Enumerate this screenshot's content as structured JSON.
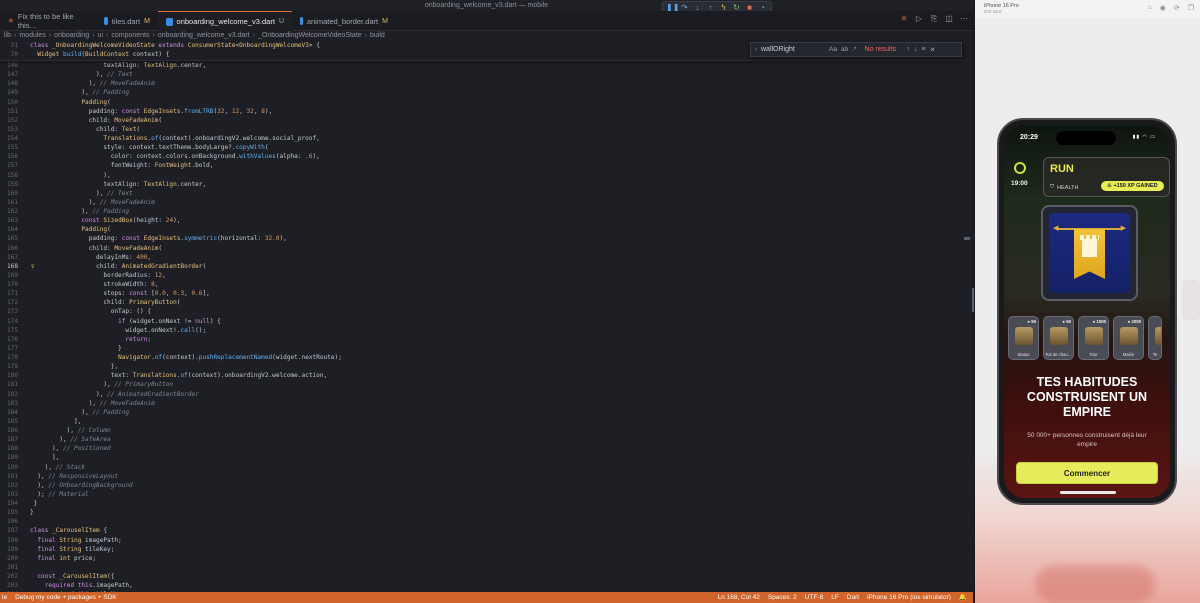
{
  "editor": {
    "window_title": "onboarding_welcome_v3.dart — mobile",
    "tabs": [
      {
        "label": "Fix this to be like this…",
        "mod": ""
      },
      {
        "label": "tiles.dart",
        "mod": "M"
      },
      {
        "label": "onboarding_welcome_v3.dart",
        "mod": "U"
      },
      {
        "label": "animated_border.dart",
        "mod": "M"
      }
    ],
    "breadcrumb": [
      "lib",
      "modules",
      "onboarding",
      "ui",
      "components",
      "onboarding_welcome_v3.dart",
      "_OnboardingWelcomeVideoState",
      "build"
    ],
    "find": {
      "query": "wallORight",
      "aa": "Aa",
      "word": "ab",
      "regex": ".*",
      "result": "No results"
    },
    "sticky": [
      {
        "num": "31",
        "html": "<span class='k'>class</span> <span class='t'>_OnboardingWelcomeVideoState</span> <span class='k'>extends</span> <span class='t'>ConsumerState</span>&lt;<span class='t'>OnboardingWelcomeV3</span>&gt; {"
      },
      {
        "num": "70",
        "html": "  <span class='t'>Widget</span> <span class='f'>build</span>(<span class='t'>BuildContext</span> context) {"
      }
    ],
    "lines": [
      {
        "num": "146",
        "html": "                    textAlign: <span class='t'>TextAlign</span>.center,"
      },
      {
        "num": "147",
        "html": "                  ), <span class='c'>// Text</span>"
      },
      {
        "num": "148",
        "html": "                ), <span class='c'>// MoveFadeAnim</span>"
      },
      {
        "num": "149",
        "html": "              ), <span class='c'>// Padding</span>"
      },
      {
        "num": "150",
        "html": "              <span class='t'>Padding</span>("
      },
      {
        "num": "151",
        "html": "                padding: <span class='k'>const</span> <span class='t'>EdgeInsets</span>.<span class='f'>fromLTRB</span>(<span class='n'>32</span>, <span class='n'>12</span>, <span class='n'>32</span>, <span class='n'>8</span>),"
      },
      {
        "num": "152",
        "html": "                child: <span class='t'>MoveFadeAnim</span>("
      },
      {
        "num": "153",
        "html": "                  child: <span class='t'>Text</span>("
      },
      {
        "num": "154",
        "html": "                    <span class='t'>Translations</span>.<span class='f'>of</span>(context).onboardingV2.welcome.social_proof,"
      },
      {
        "num": "155",
        "html": "                    style: context.textTheme.bodyLarge?.<span class='f'>copyWith</span>("
      },
      {
        "num": "156",
        "html": "                      color: context.colors.onBackground.<span class='f'>withValues</span>(alpha: <span class='n'>.6</span>),"
      },
      {
        "num": "157",
        "html": "                      fontWeight: <span class='t'>FontWeight</span>.bold,"
      },
      {
        "num": "158",
        "html": "                    ),"
      },
      {
        "num": "159",
        "html": "                    textAlign: <span class='t'>TextAlign</span>.center,"
      },
      {
        "num": "160",
        "html": "                  ), <span class='c'>// Text</span>"
      },
      {
        "num": "161",
        "html": "                ), <span class='c'>// MoveFadeAnim</span>"
      },
      {
        "num": "162",
        "html": "              ), <span class='c'>// Padding</span>"
      },
      {
        "num": "163",
        "html": "              <span class='k'>const</span> <span class='t'>SizedBox</span>(height: <span class='n'>24</span>),"
      },
      {
        "num": "164",
        "html": "              <span class='t'>Padding</span>("
      },
      {
        "num": "165",
        "html": "                padding: <span class='k'>const</span> <span class='t'>EdgeInsets</span>.<span class='f'>symmetric</span>(horizontal: <span class='n'>32.0</span>),"
      },
      {
        "num": "166",
        "html": "                child: <span class='t'>MoveFadeAnim</span>("
      },
      {
        "num": "167",
        "html": "                  delayInMs: <span class='n'>400</span>,"
      },
      {
        "num": "168",
        "html": "                  child: <span class='t'>AnimatedGradientBorder</span>("
      },
      {
        "num": "169",
        "html": "                    borderRadius: <span class='n'>12</span>,"
      },
      {
        "num": "170",
        "html": "                    strokeWidth: <span class='n'>8</span>,"
      },
      {
        "num": "171",
        "html": "                    stops: <span class='k'>const</span> [<span class='n'>0.0</span>, <span class='n'>0.3</span>, <span class='n'>0.6</span>],"
      },
      {
        "num": "172",
        "html": "                    child: <span class='t'>PrimaryButton</span>("
      },
      {
        "num": "173",
        "html": "                      onTap: () {"
      },
      {
        "num": "174",
        "html": "                        <span class='k'>if</span> (widget.onNext != <span class='k'>null</span>) {"
      },
      {
        "num": "175",
        "html": "                          widget.onNext!.<span class='f'>call</span>();"
      },
      {
        "num": "176",
        "html": "                          <span class='k'>return</span>;"
      },
      {
        "num": "177",
        "html": "                        }"
      },
      {
        "num": "178",
        "html": "                        <span class='t'>Navigator</span>.<span class='f'>of</span>(context).<span class='f'>pushReplacementNamed</span>(widget.nextRoute);"
      },
      {
        "num": "179",
        "html": "                      },"
      },
      {
        "num": "180",
        "html": "                      text: <span class='t'>Translations</span>.<span class='f'>of</span>(context).onboardingV2.welcome.action,"
      },
      {
        "num": "181",
        "html": "                    ), <span class='c'>// PrimaryButton</span>"
      },
      {
        "num": "182",
        "html": "                  ), <span class='c'>// AnimatedGradientBorder</span>"
      },
      {
        "num": "183",
        "html": "                ), <span class='c'>// MoveFadeAnim</span>"
      },
      {
        "num": "184",
        "html": "              ), <span class='c'>// Padding</span>"
      },
      {
        "num": "185",
        "html": "            ],"
      },
      {
        "num": "186",
        "html": "          ), <span class='c'>// Column</span>"
      },
      {
        "num": "187",
        "html": "        ), <span class='c'>// SafeArea</span>"
      },
      {
        "num": "188",
        "html": "      ), <span class='c'>// Positioned</span>"
      },
      {
        "num": "189",
        "html": "      ],"
      },
      {
        "num": "190",
        "html": "    ), <span class='c'>// Stack</span>"
      },
      {
        "num": "191",
        "html": "  ), <span class='c'>// ResponsiveLayout</span>"
      },
      {
        "num": "192",
        "html": "  ), <span class='c'>// OnboardingBackground</span>"
      },
      {
        "num": "193",
        "html": "  ); <span class='c'>// Material</span>"
      },
      {
        "num": "194",
        "html": " }"
      },
      {
        "num": "195",
        "html": "}"
      },
      {
        "num": "196",
        "html": ""
      },
      {
        "num": "197",
        "html": "<span class='k'>class</span> <span class='t'>_CarouselItem</span> {"
      },
      {
        "num": "198",
        "html": "  <span class='k'>final</span> <span class='t'>String</span> imagePath;"
      },
      {
        "num": "199",
        "html": "  <span class='k'>final</span> <span class='t'>String</span> tileKey;"
      },
      {
        "num": "200",
        "html": "  <span class='k'>final</span> <span class='t'>int</span> price;"
      },
      {
        "num": "201",
        "html": ""
      },
      {
        "num": "202",
        "html": "  <span class='k'>const</span> <span class='t'>_CarouselItem</span>({"
      },
      {
        "num": "203",
        "html": "    <span class='k'>required</span> <span class='k'>this</span>.imagePath,"
      },
      {
        "num": "204",
        "html": "    <span class='k'>required</span> <span class='k'>this</span>.tileKey,"
      }
    ],
    "status": {
      "left": [
        "le",
        "Debug my code + packages + SDK"
      ],
      "right": [
        "Ln 168, Col 42",
        "Spaces: 2",
        "UTF-8",
        "LF",
        "Dart",
        "iPhone 16 Pro (ios simulator)"
      ]
    }
  },
  "simulator": {
    "device": "iPhone 16 Pro",
    "os": "iOS 18.6",
    "clock": "20:29",
    "hour": "19:00",
    "run_title": "RUN",
    "health": "HEALTH",
    "xp_badge": "+150 XP GAINED",
    "carousel": [
      {
        "price": "50",
        "name": "Statue"
      },
      {
        "price": "50",
        "name": "Toit de chau…"
      },
      {
        "price": "1500",
        "name": "Tour"
      },
      {
        "price": "2000",
        "name": "Mairie"
      },
      {
        "price": "",
        "name": "Te"
      }
    ],
    "headline": "TES HABITUDES CONSTRUISENT UN EMPIRE",
    "subtitle": "50 000+ personnes construisent déjà leur empire",
    "cta": "Commencer",
    "accent_color": "#e7ec5a"
  }
}
